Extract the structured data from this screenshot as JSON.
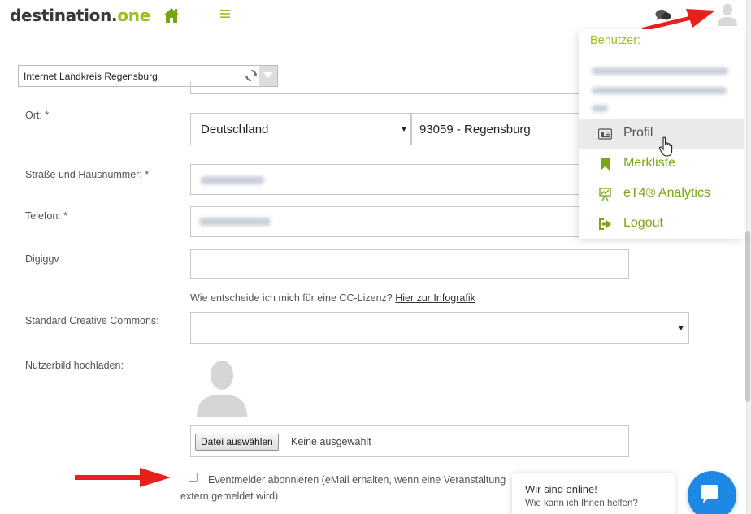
{
  "header": {
    "logo_main": "destination.",
    "logo_accent": "one",
    "icons": [
      "home-icon",
      "menu-icon",
      "chat-icon",
      "user-icon"
    ]
  },
  "site_selector": {
    "value": "Internet Landkreis Regensburg"
  },
  "form": {
    "ort_label": "Ort: *",
    "country_value": "Deutschland",
    "city_value": "93059 - Regensburg",
    "street_label": "Straße und Hausnummer: *",
    "phone_label": "Telefon: *",
    "digiggv_label": "Digiggv",
    "digiggv_value": "",
    "cc_hint": "Wie entscheide ich mich für eine CC-Lizenz?",
    "cc_link": "Hier zur Infografik",
    "cc_label": "Standard Creative Commons:",
    "cc_value": "",
    "image_label": "Nutzerbild hochladen:",
    "file_button": "Datei auswählen",
    "file_status": "Keine ausgewählt",
    "subscribe_text_line1": "Eventmelder abonnieren (eMail erhalten, wenn eine Veranstaltung",
    "subscribe_text_line2": "extern gemeldet wird)"
  },
  "user_menu": {
    "title": "Benutzer:",
    "items": [
      {
        "label": "Profil",
        "icon": "profile-card-icon"
      },
      {
        "label": "Merkliste",
        "icon": "bookmark-icon"
      },
      {
        "label": "eT4® Analytics",
        "icon": "analytics-icon"
      },
      {
        "label": "Logout",
        "icon": "logout-icon"
      }
    ]
  },
  "chat_widget": {
    "line1": "Wir sind online!",
    "line2": "Wie kann ich Ihnen helfen?"
  },
  "colors": {
    "brand_green": "#9ac21e",
    "arrow_red": "#e8201c",
    "chat_blue": "#1e88e5"
  }
}
